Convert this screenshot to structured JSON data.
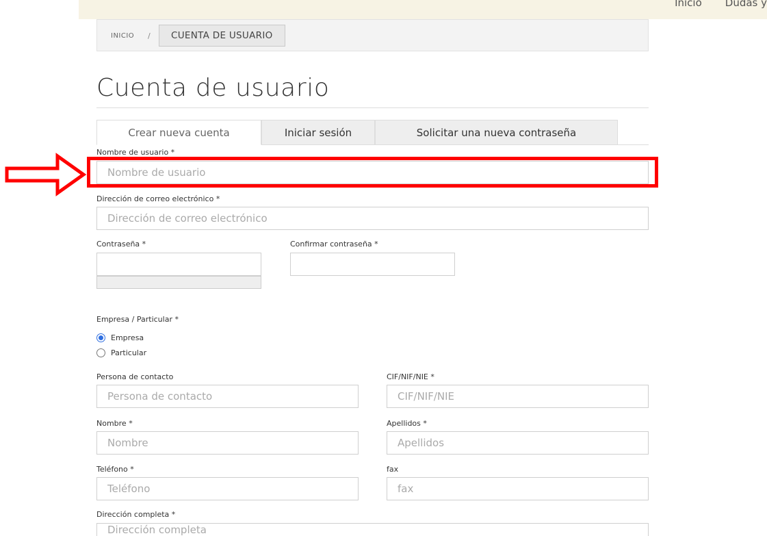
{
  "topnav": {
    "items": [
      "Inicio",
      "Dudas y"
    ]
  },
  "breadcrumb": {
    "home": "INICIO",
    "separator": "/",
    "current": "CUENTA DE USUARIO"
  },
  "page": {
    "title": "Cuenta de usuario"
  },
  "tabs": [
    {
      "label": "Crear nueva cuenta",
      "active": true
    },
    {
      "label": "Iniciar sesión",
      "active": false
    },
    {
      "label": "Solicitar una nueva contraseña",
      "active": false
    }
  ],
  "form": {
    "username": {
      "label": "Nombre de usuario *",
      "placeholder": "Nombre de usuario",
      "value": ""
    },
    "email": {
      "label": "Dirección de correo electrónico *",
      "placeholder": "Dirección de correo electrónico",
      "value": ""
    },
    "password": {
      "label": "Contraseña *",
      "value": ""
    },
    "confirm_password": {
      "label": "Confirmar contraseña *",
      "value": ""
    },
    "type": {
      "label": "Empresa / Particular *",
      "options": [
        "Empresa",
        "Particular"
      ],
      "selected": "Empresa"
    },
    "contact": {
      "label": "Persona de contacto",
      "placeholder": "Persona de contacto"
    },
    "cif": {
      "label": "CIF/NIF/NIE *",
      "placeholder": "CIF/NIF/NIE"
    },
    "nombre": {
      "label": "Nombre *",
      "placeholder": "Nombre"
    },
    "apellidos": {
      "label": "Apellidos *",
      "placeholder": "Apellidos"
    },
    "telefono": {
      "label": "Teléfono *",
      "placeholder": "Teléfono"
    },
    "fax": {
      "label": "fax",
      "placeholder": "fax"
    },
    "direccion": {
      "label": "Dirección completa *",
      "placeholder": "Dirección completa"
    }
  },
  "colors": {
    "highlight": "#ff0000",
    "accent": "#2f6fe0",
    "topbar": "#f7f3e4"
  }
}
